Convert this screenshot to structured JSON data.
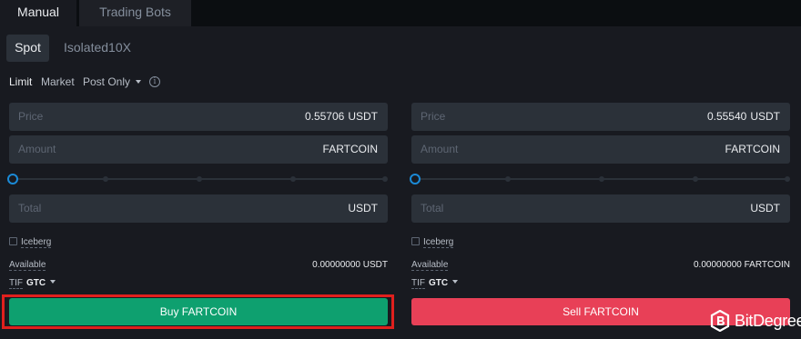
{
  "top_tabs": {
    "manual": "Manual",
    "trading_bots": "Trading Bots"
  },
  "sub_tabs": {
    "spot": "Spot",
    "isolated": "Isolated10X"
  },
  "order_types": {
    "limit": "Limit",
    "market": "Market",
    "post_only": "Post Only",
    "info_icon": "i"
  },
  "buy": {
    "price_label": "Price",
    "price_value": "0.55706",
    "price_unit": "USDT",
    "amount_label": "Amount",
    "amount_unit": "FARTCOIN",
    "total_label": "Total",
    "total_unit": "USDT",
    "iceberg_label": "Iceberg",
    "available_label": "Available",
    "available_value": "0.00000000 USDT",
    "tif_label": "TIF",
    "tif_value": "GTC",
    "button_label": "Buy FARTCOIN",
    "button_color": "#0ea06f",
    "slider_level": 0
  },
  "sell": {
    "price_label": "Price",
    "price_value": "0.55540",
    "price_unit": "USDT",
    "amount_label": "Amount",
    "amount_unit": "FARTCOIN",
    "total_label": "Total",
    "total_unit": "USDT",
    "iceberg_label": "Iceberg",
    "available_label": "Available",
    "available_value": "0.00000000 FARTCOIN",
    "tif_label": "TIF",
    "tif_value": "GTC",
    "button_label": "Sell FARTCOIN",
    "button_color": "#e84057",
    "slider_level": 0
  },
  "highlight_color": "#e0201d",
  "watermark": {
    "text": "BitDegree"
  }
}
